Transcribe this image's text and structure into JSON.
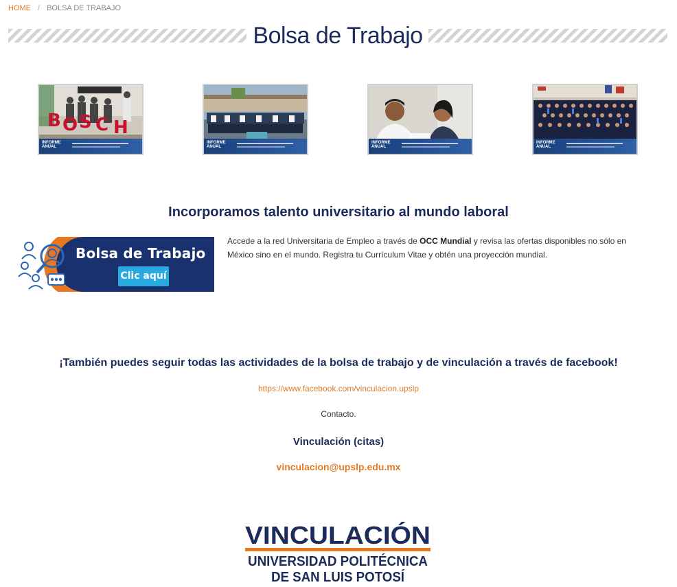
{
  "breadcrumb": {
    "home": "HOME",
    "separator": "/",
    "current": "BOLSA DE TRABAJO"
  },
  "page_title": "Bolsa de Trabajo",
  "gallery": [
    {
      "alt": "photo-bosch"
    },
    {
      "alt": "photo-group"
    },
    {
      "alt": "photo-interview"
    },
    {
      "alt": "photo-graduation"
    }
  ],
  "section": {
    "heading": "Incorporamos talento universitario al mundo laboral",
    "banner_title": "Bolsa de Trabajo",
    "banner_button": "Clic aquí",
    "text_before": "Accede a la red Universitaria de Empleo a través de ",
    "text_bold": "OCC Mundial",
    "text_after": " y revisa las ofertas disponibles no sólo en México sino en el mundo. Registra tu Currículum Vitae y obtén una proyección mundial."
  },
  "facebook": {
    "heading": "¡También puedes seguir todas las actividades de la bolsa de trabajo y de vinculación a través de facebook!",
    "link": "https://www.facebook.com/vinculacion.upslp"
  },
  "contact": {
    "label": "Contacto.",
    "heading": "Vinculación (citas)",
    "email": "vinculacion@upslp.edu.mx"
  },
  "logo": {
    "line1": "VINCULACIÓN",
    "line2": "UNIVERSIDAD POLITÉCNICA",
    "line3": "DE SAN LUIS POTOSÍ"
  },
  "colors": {
    "navy": "#1c2b5a",
    "orange": "#e07a26",
    "button_blue": "#2aa9e0"
  }
}
